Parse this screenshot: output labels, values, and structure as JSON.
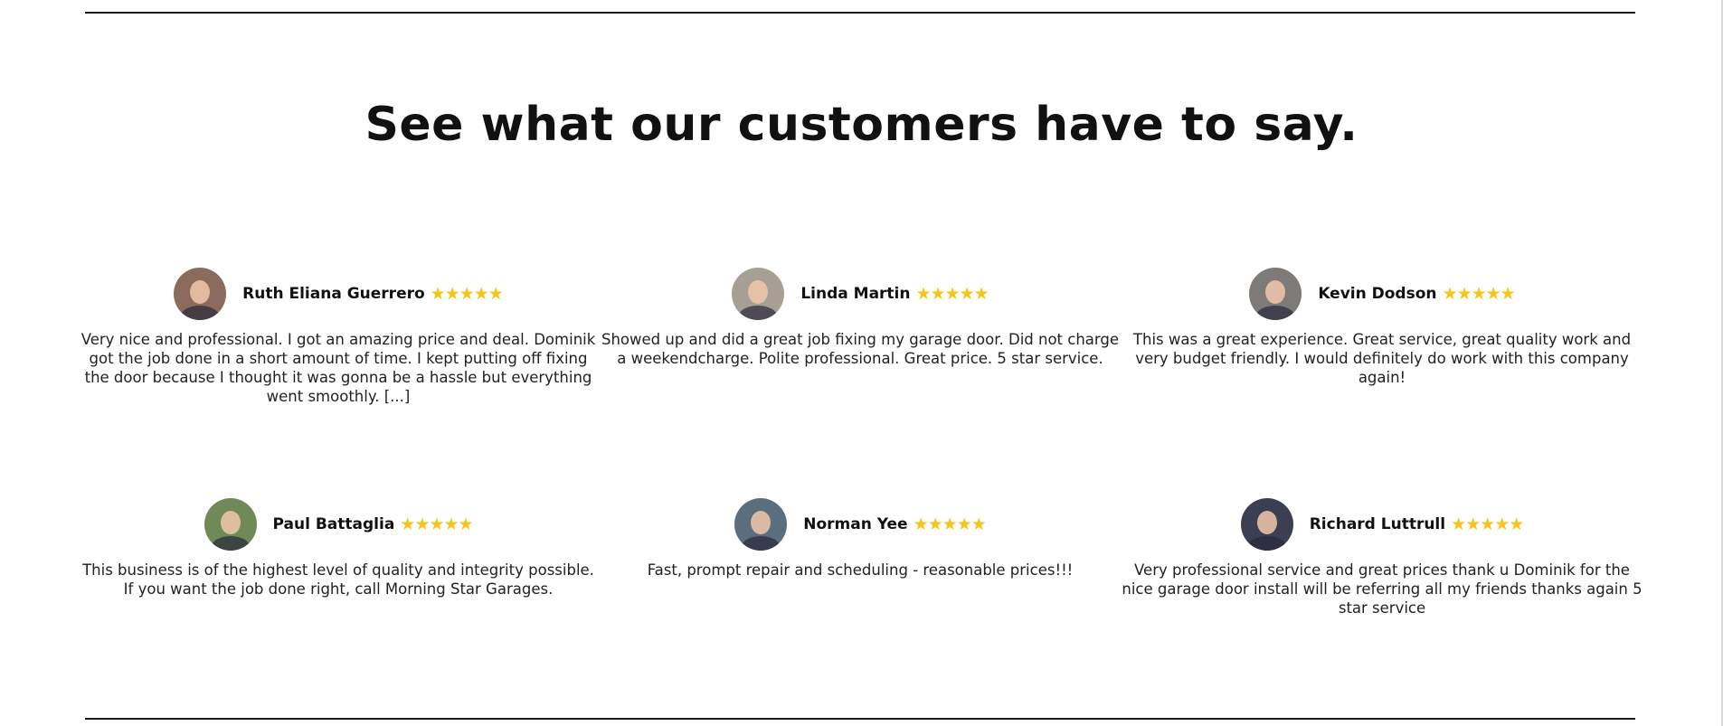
{
  "heading": "See what our customers have to say.",
  "star_color": "#f5c518",
  "reviews": [
    {
      "name": "Ruth Eliana Guerrero",
      "stars": "★★★★★",
      "rating": 5,
      "text": "Very nice and professional. I got an amazing price and deal. Dominik got the job done in a short amount of time. I kept putting off fixing the door because I thought it was gonna be a hassle but everything went smoothly. [...]",
      "avatar_color": "#8a6b5c"
    },
    {
      "name": "Linda Martin",
      "stars": "★★★★★",
      "rating": 5,
      "text": "Showed up and did a great job fixing my garage door. Did not charge a weekendcharge. Polite professional. Great price. 5 star service.",
      "avatar_color": "#a89f94"
    },
    {
      "name": "Kevin Dodson",
      "stars": "★★★★★",
      "rating": 5,
      "text": "This was a great experience. Great service, great quality work and very budget friendly. I would definitely do work with this company again!",
      "avatar_color": "#7d7a78"
    },
    {
      "name": "Paul Battaglia",
      "stars": "★★★★★",
      "rating": 5,
      "text": "This business is of the highest level of quality and integrity possible. If you want the job done right, call Morning Star Garages.",
      "avatar_color": "#6f8a58"
    },
    {
      "name": "Norman Yee",
      "stars": "★★★★★",
      "rating": 5,
      "text": "Fast, prompt repair and scheduling - reasonable prices!!!",
      "avatar_color": "#5b6e7d"
    },
    {
      "name": "Richard Luttrull",
      "stars": "★★★★★",
      "rating": 5,
      "text": "Very professional service and great prices thank u Dominik for the nice garage door install will be referring all my friends thanks again 5 star service",
      "avatar_color": "#3c3f52"
    }
  ]
}
